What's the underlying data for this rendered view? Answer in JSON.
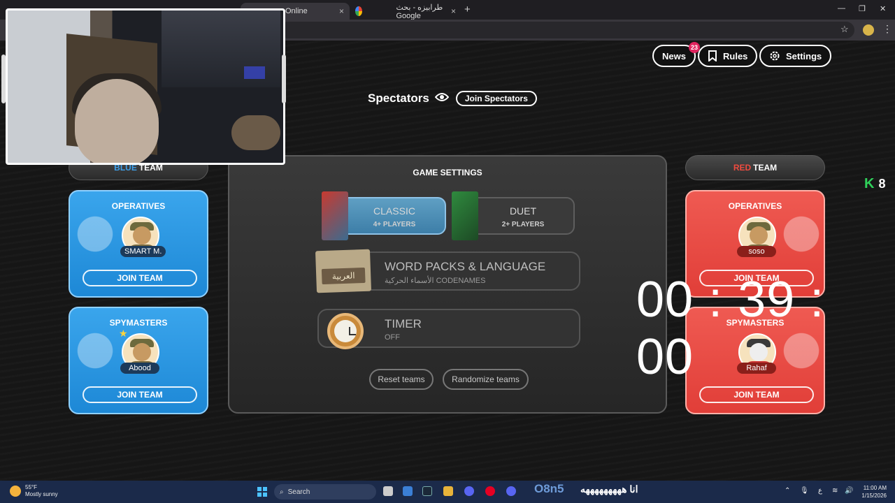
{
  "browser": {
    "tabs": [
      {
        "label": "Online",
        "close": "×"
      },
      {
        "label": "طرابيزه - بحث Google",
        "close": "×"
      }
    ],
    "new_tab": "+",
    "window_controls": [
      "—",
      "❐",
      "✕"
    ]
  },
  "header": {
    "news_label": "News",
    "news_count": "23",
    "rules_label": "Rules",
    "settings_label": "Settings"
  },
  "spectators": {
    "title": "Spectators",
    "join_label": "Join Spectators"
  },
  "blue_team": {
    "prefix": "BLUE",
    "suffix": "TEAM",
    "operatives": {
      "title": "OPERATIVES",
      "player": "SMART M.",
      "join": "JOIN TEAM"
    },
    "spymasters": {
      "title": "SPYMASTERS",
      "player": "Abood",
      "join": "JOIN TEAM"
    }
  },
  "red_team": {
    "prefix": "RED",
    "suffix": "TEAM",
    "operatives": {
      "title": "OPERATIVES",
      "player": "soso",
      "join": "JOIN TEAM"
    },
    "spymasters": {
      "title": "SPYMASTERS",
      "player": "Rahaf",
      "join": "JOIN TEAM"
    }
  },
  "game_settings": {
    "title": "GAME SETTINGS",
    "modes": [
      {
        "name": "CLASSIC",
        "players": "4+ PLAYERS",
        "selected": true
      },
      {
        "name": "DUET",
        "players": "2+ PLAYERS",
        "selected": false
      }
    ],
    "word_packs": {
      "title": "WORD PACKS & LANGUAGE",
      "value": "الأسماء الحركية CODENAMES",
      "box_label": "العربية"
    },
    "timer": {
      "title": "TIMER",
      "value": "OFF"
    },
    "reset_label": "Reset teams",
    "randomize_label": "Randomize teams"
  },
  "overlay": {
    "countdown": "00 : 39 : 00",
    "kick_count": "8",
    "kick_letter": "K"
  },
  "taskbar": {
    "weather_temp": "55°F",
    "weather_desc": "Mostly sunny",
    "search_placeholder": "Search",
    "stream_text": "O8n5",
    "stream_arabic": "انا هههههههههه",
    "lang": "ع",
    "time": "11:00 AM",
    "date": "1/15/2026"
  },
  "colors": {
    "blue_team": "#3ea0ea",
    "red_team": "#ef4b3f",
    "kick_green": "#2fd15a",
    "news_badge": "#e0245e"
  }
}
